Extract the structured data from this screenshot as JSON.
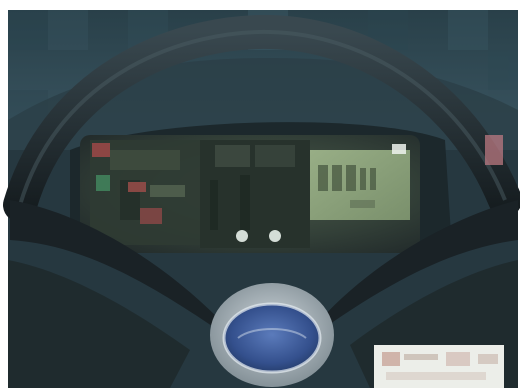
{
  "scene": {
    "description_visible": false,
    "colors": {
      "frame": "#ffffff",
      "sky_top": "#2f4a55",
      "sky_mid": "#3d5a66",
      "dash_dark": "#1f2d33",
      "dash_mid": "#2a3c44",
      "cluster_bg": "#2e3a3a",
      "cluster_panel": "#3f4d3f",
      "lcd": "#8fa67e",
      "lcd_dark": "#6c8060",
      "wheel": "#1c2428",
      "wheel_highlight": "#3a4a52",
      "emblem_rim": "#b9c4cc",
      "emblem_blue": "#3d5c9a",
      "emblem_ring": "#e6edf2",
      "red_light": "#a34a4a",
      "green_light": "#3f7a57",
      "white_light": "#e8f0ea",
      "tag_bg": "#e9ece6",
      "tag_text": "#c9b0a4"
    },
    "elements": [
      "windshield-area",
      "dashboard",
      "instrument-cluster",
      "lcd-display",
      "steering-wheel",
      "steering-wheel-emblem",
      "warning-lights",
      "sticker-bottom-right"
    ]
  }
}
